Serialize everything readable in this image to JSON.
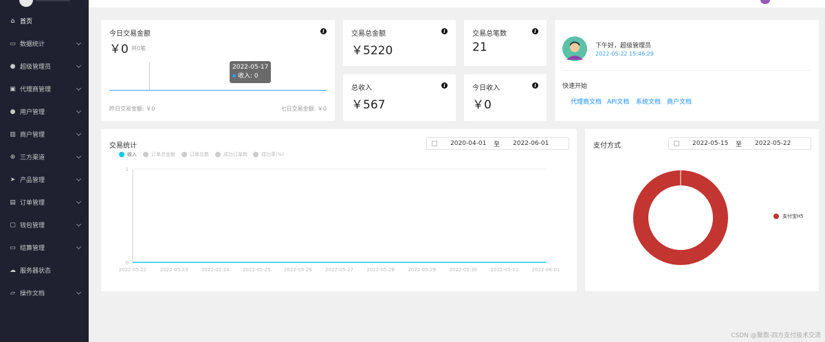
{
  "sidebar": {
    "items": [
      {
        "label": "首页",
        "icon": "home-icon",
        "active": true,
        "expand": false
      },
      {
        "label": "数据统计",
        "icon": "chart-icon",
        "active": false,
        "expand": true
      },
      {
        "label": "超级管理员",
        "icon": "user-icon",
        "active": false,
        "expand": true
      },
      {
        "label": "代理商管理",
        "icon": "briefcase-icon",
        "active": false,
        "expand": true
      },
      {
        "label": "用户管理",
        "icon": "user-icon",
        "active": false,
        "expand": true
      },
      {
        "label": "商户管理",
        "icon": "shop-icon",
        "active": false,
        "expand": true
      },
      {
        "label": "三方渠道",
        "icon": "plus-circle-icon",
        "active": false,
        "expand": true
      },
      {
        "label": "产品管理",
        "icon": "send-icon",
        "active": false,
        "expand": true
      },
      {
        "label": "订单管理",
        "icon": "order-icon",
        "active": false,
        "expand": true
      },
      {
        "label": "钱包管理",
        "icon": "wallet-icon",
        "active": false,
        "expand": true
      },
      {
        "label": "结算管理",
        "icon": "card-icon",
        "active": false,
        "expand": true
      },
      {
        "label": "服务器状态",
        "icon": "cloud-icon",
        "active": false,
        "expand": false
      },
      {
        "label": "操作文档",
        "icon": "folder-icon",
        "active": false,
        "expand": true
      }
    ]
  },
  "today": {
    "title": "今日交易金额",
    "value": "￥0",
    "count": "共0笔",
    "tooltip_date": "2022-05-17",
    "tooltip_value": "收入: 0",
    "yesterday": "昨日交易金额: ￥0",
    "week": "七日交易金额: ￥0"
  },
  "stats": {
    "total_amount_title": "交易总金额",
    "total_amount": "￥5220",
    "total_count_title": "交易总笔数",
    "total_count": "21",
    "total_income_title": "总收入",
    "total_income": "￥567",
    "today_income_title": "今日收入",
    "today_income": "￥0"
  },
  "welcome": {
    "greeting": "下午好，超级管理员",
    "time": "2022-05-22 15:46:29",
    "quick_title": "快速开始",
    "links": [
      "代理商文档",
      "API文档",
      "系统文档",
      "商户文档"
    ]
  },
  "trade_chart": {
    "title": "交易统计",
    "date_start": "2020-04-01",
    "date_sep": "至",
    "date_end": "2022-06-01",
    "legend": [
      {
        "label": "收入",
        "active": true
      },
      {
        "label": "订单总金额",
        "active": false
      },
      {
        "label": "订单总数",
        "active": false
      },
      {
        "label": "成功订单数",
        "active": false
      },
      {
        "label": "成功率(%)",
        "active": false
      }
    ]
  },
  "pay_chart": {
    "title": "支付方式",
    "date_start": "2022-05-15",
    "date_sep": "至",
    "date_end": "2022-05-22",
    "legend_label": "支付宝H5",
    "color": "#c23531"
  },
  "chart_data": [
    {
      "type": "line",
      "title": "交易统计",
      "x": [
        "2022-05-22",
        "2022-05-23",
        "2022-05-24",
        "2022-05-25",
        "2022-05-26",
        "2022-05-27",
        "2022-05-28",
        "2022-05-29",
        "2022-05-30",
        "2022-05-11",
        "2022-06-01"
      ],
      "series": [
        {
          "name": "收入",
          "values": [
            0,
            0,
            0,
            0,
            0,
            0,
            0,
            0,
            0,
            0,
            0
          ]
        }
      ],
      "ylim": [
        0,
        1
      ],
      "yticks": [
        "0",
        "1"
      ],
      "color": "#12c9e5"
    },
    {
      "type": "pie",
      "title": "支付方式",
      "labels": [
        "支付宝H5"
      ],
      "values": [
        100
      ],
      "donut": true,
      "color": "#c23531"
    }
  ],
  "watermark": "CSDN @聚鼎-四方支付技术交流"
}
